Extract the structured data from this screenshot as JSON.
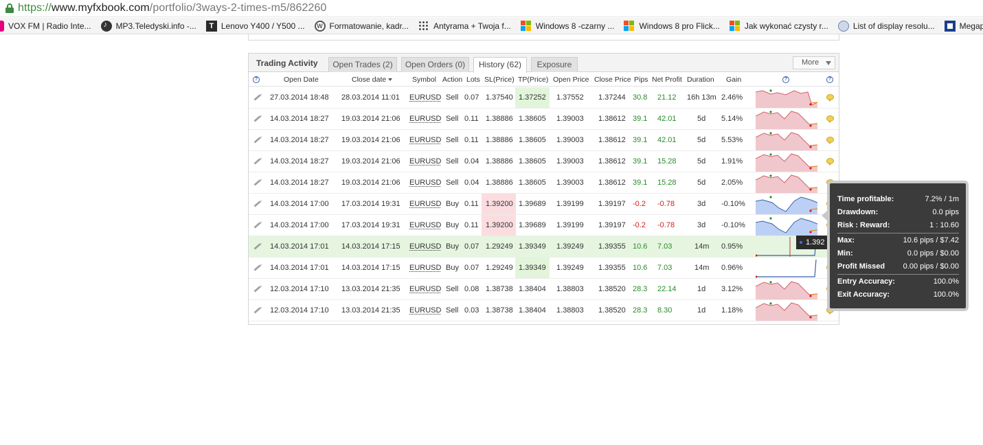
{
  "browser": {
    "url_scheme": "https://",
    "url_host": "www.myfxbook.com",
    "url_path": "/portfolio/3ways-2-times-m5/862260",
    "bookmarks": [
      {
        "label": "VOX FM | Radio Inte...",
        "icon": "go-icon"
      },
      {
        "label": "MP3.Teledyski.info -...",
        "icon": "music-icon"
      },
      {
        "label": "Lenovo Y400 / Y500 ...",
        "icon": "tv-icon"
      },
      {
        "label": "Formatowanie, kadr...",
        "icon": "wordpress-icon"
      },
      {
        "label": "Antyrama + Twoja f...",
        "icon": "grid-icon"
      },
      {
        "label": "Windows 8 -czarny ...",
        "icon": "windows-icon"
      },
      {
        "label": "Windows 8 pro Flick...",
        "icon": "windows-icon"
      },
      {
        "label": "Jak wykonać czysty r...",
        "icon": "windows-icon"
      },
      {
        "label": "List of display resolu...",
        "icon": "drop-icon"
      },
      {
        "label": "Megapixels ı",
        "icon": "megapixels-icon"
      }
    ]
  },
  "widget": {
    "title": "Trading Activity",
    "tabs": [
      {
        "label": "Open Trades (2)",
        "active": false
      },
      {
        "label": "Open Orders (0)",
        "active": false
      },
      {
        "label": "History (62)",
        "active": true
      },
      {
        "label": "Exposure",
        "active": false
      }
    ],
    "more_label": "More",
    "columns": {
      "open_date": "Open Date",
      "close_date": "Close date",
      "symbol": "Symbol",
      "action": "Action",
      "lots": "Lots",
      "sl": "SL(Price)",
      "tp": "TP(Price)",
      "open_price": "Open Price",
      "close_price": "Close Price",
      "pips": "Pips",
      "net_profit": "Net Profit",
      "duration": "Duration",
      "gain": "Gain",
      "help": "?"
    },
    "rows": [
      {
        "open": "27.03.2014 18:48",
        "close": "28.03.2014 11:01",
        "symbol": "EURUSD",
        "action": "Sell",
        "lots": "0.07",
        "sl": "1.37540",
        "tp": "1.37252",
        "open_price": "1.37552",
        "close_price": "1.37244",
        "pips": "30.8",
        "profit": "21.12",
        "duration": "16h 13m",
        "gain": "2.46%",
        "positive": true,
        "tp_hl": true,
        "sl_hl": false
      },
      {
        "open": "14.03.2014 18:27",
        "close": "19.03.2014 21:06",
        "symbol": "EURUSD",
        "action": "Sell",
        "lots": "0.11",
        "sl": "1.38886",
        "tp": "1.38605",
        "open_price": "1.39003",
        "close_price": "1.38612",
        "pips": "39.1",
        "profit": "42.01",
        "duration": "5d",
        "gain": "5.14%",
        "positive": true,
        "tp_hl": false,
        "sl_hl": false
      },
      {
        "open": "14.03.2014 18:27",
        "close": "19.03.2014 21:06",
        "symbol": "EURUSD",
        "action": "Sell",
        "lots": "0.11",
        "sl": "1.38886",
        "tp": "1.38605",
        "open_price": "1.39003",
        "close_price": "1.38612",
        "pips": "39.1",
        "profit": "42.01",
        "duration": "5d",
        "gain": "5.53%",
        "positive": true,
        "tp_hl": false,
        "sl_hl": false
      },
      {
        "open": "14.03.2014 18:27",
        "close": "19.03.2014 21:06",
        "symbol": "EURUSD",
        "action": "Sell",
        "lots": "0.04",
        "sl": "1.38886",
        "tp": "1.38605",
        "open_price": "1.39003",
        "close_price": "1.38612",
        "pips": "39.1",
        "profit": "15.28",
        "duration": "5d",
        "gain": "1.91%",
        "positive": true,
        "tp_hl": false,
        "sl_hl": false
      },
      {
        "open": "14.03.2014 18:27",
        "close": "19.03.2014 21:06",
        "symbol": "EURUSD",
        "action": "Sell",
        "lots": "0.04",
        "sl": "1.38886",
        "tp": "1.38605",
        "open_price": "1.39003",
        "close_price": "1.38612",
        "pips": "39.1",
        "profit": "15.28",
        "duration": "5d",
        "gain": "2.05%",
        "positive": true,
        "tp_hl": false,
        "sl_hl": false
      },
      {
        "open": "14.03.2014 17:00",
        "close": "17.03.2014 19:31",
        "symbol": "EURUSD",
        "action": "Buy",
        "lots": "0.11",
        "sl": "1.39200",
        "tp": "1.39689",
        "open_price": "1.39199",
        "close_price": "1.39197",
        "pips": "-0.2",
        "profit": "-0.78",
        "duration": "3d",
        "gain": "-0.10%",
        "positive": false,
        "tp_hl": false,
        "sl_hl": true
      },
      {
        "open": "14.03.2014 17:00",
        "close": "17.03.2014 19:31",
        "symbol": "EURUSD",
        "action": "Buy",
        "lots": "0.11",
        "sl": "1.39200",
        "tp": "1.39689",
        "open_price": "1.39199",
        "close_price": "1.39197",
        "pips": "-0.2",
        "profit": "-0.78",
        "duration": "3d",
        "gain": "-0.10%",
        "positive": false,
        "tp_hl": false,
        "sl_hl": true
      },
      {
        "open": "14.03.2014 17:01",
        "close": "14.03.2014 17:15",
        "symbol": "EURUSD",
        "action": "Buy",
        "lots": "0.07",
        "sl": "1.29249",
        "tp": "1.39349",
        "open_price": "1.39249",
        "close_price": "1.39355",
        "pips": "10.6",
        "profit": "7.03",
        "duration": "14m",
        "gain": "0.95%",
        "positive": true,
        "tp_hl": false,
        "sl_hl": false,
        "row_hl": true
      },
      {
        "open": "14.03.2014 17:01",
        "close": "14.03.2014 17:15",
        "symbol": "EURUSD",
        "action": "Buy",
        "lots": "0.07",
        "sl": "1.29249",
        "tp": "1.39349",
        "open_price": "1.39249",
        "close_price": "1.39355",
        "pips": "10.6",
        "profit": "7.03",
        "duration": "14m",
        "gain": "0.96%",
        "positive": true,
        "tp_hl": true,
        "sl_hl": false
      },
      {
        "open": "12.03.2014 17:10",
        "close": "13.03.2014 21:35",
        "symbol": "EURUSD",
        "action": "Sell",
        "lots": "0.08",
        "sl": "1.38738",
        "tp": "1.38404",
        "open_price": "1.38803",
        "close_price": "1.38520",
        "pips": "28.3",
        "profit": "22.14",
        "duration": "1d",
        "gain": "3.12%",
        "positive": true,
        "tp_hl": false,
        "sl_hl": false
      },
      {
        "open": "12.03.2014 17:10",
        "close": "13.03.2014 21:35",
        "symbol": "EURUSD",
        "action": "Sell",
        "lots": "0.03",
        "sl": "1.38738",
        "tp": "1.38404",
        "open_price": "1.38803",
        "close_price": "1.38520",
        "pips": "28.3",
        "profit": "8.30",
        "duration": "1d",
        "gain": "1.18%",
        "positive": true,
        "tp_hl": false,
        "sl_hl": false
      }
    ],
    "hover_price": "1.392"
  },
  "tooltip": {
    "rows": [
      {
        "k": "Time profitable:",
        "v": "7.2% / 1m"
      },
      {
        "k": "Drawdown:",
        "v": "0.0 pips"
      },
      {
        "k": "Risk : Reward:",
        "v": "1 : 10.60"
      },
      {
        "k": "Max:",
        "v": "10.6 pips / $7.42"
      },
      {
        "k": "Min:",
        "v": "0.0 pips / $0.00"
      },
      {
        "k": "Profit Missed",
        "v": "0.00 pips / $0.00"
      },
      {
        "k": "Entry Accuracy:",
        "v": "100.0%"
      },
      {
        "k": "Exit Accuracy:",
        "v": "100.0%"
      }
    ]
  },
  "colors": {
    "profit": "#2a8a2a",
    "loss": "#d21e1e",
    "tp_highlight": "#e2f5da",
    "sl_highlight": "#fbdde0",
    "row_highlight": "#e6f5e0",
    "spark_sell_fill": "#f0c7cc",
    "spark_buy_fill": "#bcd0f5"
  }
}
